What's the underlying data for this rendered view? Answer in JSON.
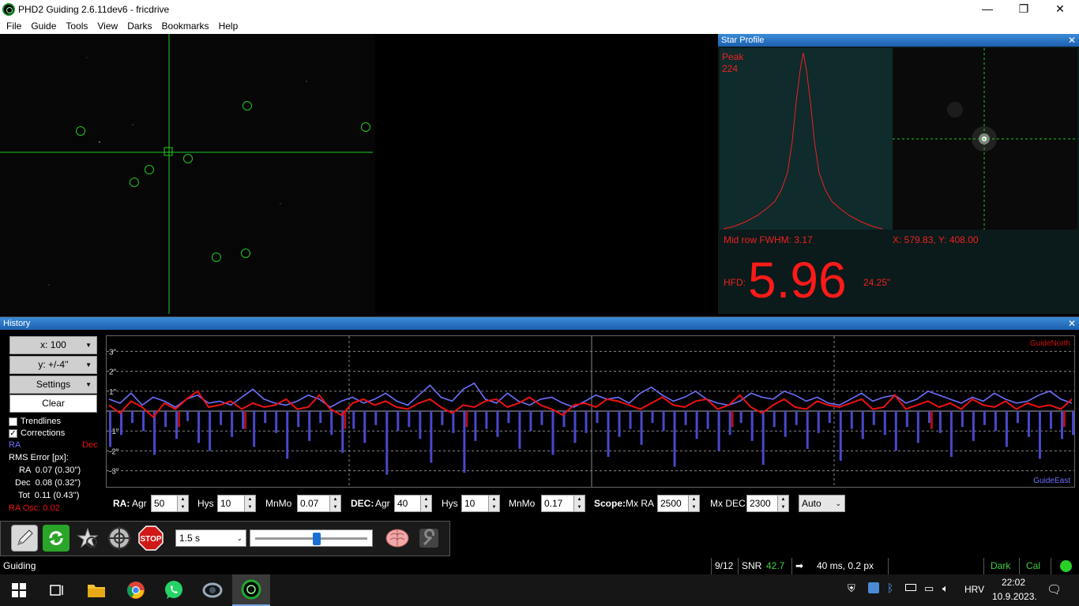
{
  "window": {
    "title": "PHD2 Guiding 2.6.11dev6 - fricdrive",
    "minimize": "—",
    "maximize": "❐",
    "close": "✕"
  },
  "menu": [
    "File",
    "Guide",
    "Tools",
    "View",
    "Darks",
    "Bookmarks",
    "Help"
  ],
  "star_profile": {
    "title": "Star Profile",
    "peak_label": "Peak",
    "peak_value": "224",
    "fwhm": "Mid row FWHM: 3.17",
    "coords": "X: 579.83, Y: 408.00",
    "hfd_label": "HFD:",
    "hfd_value": "5.96",
    "hfd_arcsec": "24.25\""
  },
  "history": {
    "title": "History",
    "x_scale": "x: 100",
    "y_scale": "y: +/-4''",
    "settings": "Settings",
    "clear": "Clear",
    "trendlines": "Trendlines",
    "corrections": "Corrections",
    "ra_label": "RA",
    "dec_label": "Dec",
    "rms_title": "RMS Error [px]:",
    "rms_ra": "RA  0.07 (0.30'')",
    "rms_dec": "Dec  0.08 (0.32'')",
    "rms_tot": "Tot  0.11 (0.43'')",
    "ra_osc": "RA Osc: 0.02",
    "guide_north": "GuideNorth",
    "guide_east": "GuideEast",
    "y_ticks": [
      "3\"",
      "2\"",
      "1\"",
      "-1\"",
      "-2\"",
      "-3\""
    ]
  },
  "chart_data": {
    "type": "line",
    "ylim": [
      -4,
      4
    ],
    "series": [
      {
        "name": "RA",
        "color": "#6f6fff",
        "values": [
          0.6,
          0.4,
          0.9,
          0.3,
          0.7,
          0.5,
          0.2,
          0.6,
          0.8,
          0.4,
          0.5,
          0.3,
          0.7,
          1.1,
          0.6,
          0.4,
          0.3,
          0.5,
          0.8,
          0.6,
          0.2,
          0.5,
          0.7,
          0.4,
          0.6,
          0.9,
          0.5,
          0.3,
          0.8,
          1.3,
          0.7,
          0.5,
          1.1,
          1.4,
          0.6,
          0.4,
          0.9,
          0.5,
          0.3,
          0.6,
          0.7,
          0.4,
          0.2,
          0.5,
          0.8,
          0.6,
          0.7,
          0.4,
          0.9,
          1.2,
          0.8,
          0.5,
          0.7,
          1.0,
          0.6,
          0.4,
          0.3,
          0.5,
          0.9,
          0.7,
          0.6,
          1.0,
          0.8,
          0.5,
          0.7,
          0.4,
          0.3,
          0.6,
          0.9,
          0.5,
          0.7,
          0.8,
          0.4,
          0.6,
          1.0,
          0.8,
          0.6,
          0.4,
          0.7,
          0.5,
          0.9,
          0.6,
          0.4,
          0.5,
          0.8,
          1.0,
          0.6,
          0.4
        ]
      },
      {
        "name": "Dec",
        "color": "#ee1111",
        "values": [
          0.3,
          -0.1,
          0.5,
          0.2,
          -0.3,
          0.4,
          0.1,
          0.6,
          1.0,
          0.2,
          0.3,
          0.5,
          0.1,
          0.4,
          0.2,
          0.3,
          0.6,
          0.1,
          0.2,
          0.8,
          0.1,
          -0.2,
          0.4,
          0.6,
          0.3,
          0.5,
          0.2,
          0.1,
          0.4,
          0.6,
          0.2,
          -0.1,
          0.3,
          0.2,
          0.5,
          0.6,
          0.2,
          0.4,
          0.7,
          0.3,
          0.1,
          -0.2,
          0.3,
          0.4,
          0.2,
          0.6,
          0.5,
          0.3,
          0.1,
          0.4,
          0.7,
          0.3,
          0.2,
          0.5,
          0.6,
          0.1,
          0.3,
          0.8,
          0.2,
          -0.1,
          0.3,
          0.6,
          0.2,
          0.1,
          0.5,
          0.3,
          0.2,
          0.4,
          0.6,
          0.1,
          0.2,
          0.8,
          0.1,
          0.3,
          0.5,
          0.2,
          0.4,
          0.1,
          0.6,
          0.3,
          0.2,
          0.5,
          0.1,
          0.4,
          0.2,
          0.3,
          0.1,
          0.6
        ]
      },
      {
        "name": "RA corrections",
        "color": "#4848cc",
        "values": [
          -1.8,
          -1.2,
          -0.6,
          -1.0,
          -2.2,
          -0.8,
          -1.4,
          -0.5,
          -1.6,
          -2.0,
          -0.7,
          -1.3,
          -0.9,
          -1.8,
          -0.6,
          -1.1,
          -2.4,
          -0.8,
          -1.5,
          -0.6,
          -1.2,
          -2.1,
          -0.9,
          -1.6,
          -0.7,
          -3.2,
          -1.0,
          -0.8,
          -1.4,
          -2.6,
          -0.7,
          -1.1,
          -3.1,
          -1.5,
          -0.9,
          -1.3,
          -0.6,
          -1.9,
          -1.0,
          -0.7,
          -2.2,
          -0.8,
          -1.6,
          -1.1,
          -0.6,
          -2.3,
          -1.3,
          -0.9,
          -1.7,
          -0.6,
          -1.0,
          -2.8,
          -0.7,
          -1.4,
          -0.9,
          -2.0,
          -1.2,
          -0.6,
          -1.5,
          -2.7,
          -0.8,
          -1.3,
          -0.7,
          -1.9,
          -1.1,
          -0.6,
          -2.5,
          -0.9,
          -1.4,
          -0.7,
          -1.2,
          -2.0,
          -0.8,
          -1.6,
          -0.6,
          -1.1,
          -2.3,
          -0.8,
          -1.5,
          -0.7,
          -1.0,
          -1.8,
          -0.6,
          -1.3,
          -2.4,
          -0.9,
          -1.4,
          -1.2
        ]
      },
      {
        "name": "Dec corrections",
        "color": "#aa1111",
        "values": [
          0,
          0,
          0,
          0,
          0,
          0,
          -0.8,
          0,
          0,
          0,
          0,
          0,
          -0.9,
          0,
          0,
          0,
          0,
          0,
          0,
          0,
          0,
          -0.9,
          0,
          0,
          0,
          0,
          0,
          0,
          0,
          0,
          0,
          0,
          -0.8,
          0,
          0,
          0,
          0,
          0,
          0,
          0,
          0,
          0,
          0,
          0,
          0,
          0,
          0,
          0,
          0,
          0,
          0,
          0,
          0,
          0,
          0,
          0,
          -0.8,
          0,
          0,
          0,
          0,
          0,
          0,
          0,
          0,
          0,
          0,
          0,
          0,
          0,
          0,
          0,
          0,
          0,
          -0.9,
          0,
          0,
          0,
          0,
          0,
          0,
          0,
          0,
          0,
          0,
          0,
          -0.8,
          0
        ]
      }
    ]
  },
  "params": {
    "ra_label": "RA:",
    "agr_label": "Agr",
    "ra_agr": "50",
    "hys_label": "Hys",
    "ra_hys": "10",
    "mnmo_label": "MnMo",
    "ra_mnmo": "0.07",
    "dec_label": "DEC:",
    "dec_agr": "40",
    "dec_hys": "10",
    "dec_mnmo": "0.17",
    "scope_label": "Scope:",
    "mxra_label": "Mx RA",
    "mxra": "2500",
    "mxdec_label": "Mx DEC",
    "mxdec": "2300",
    "mode": "Auto"
  },
  "toolbar": {
    "exposure": "1.5 s",
    "exposure_slider_pct": 55
  },
  "status": {
    "guiding": "Guiding",
    "frame": "9/12",
    "snr_label": "SNR",
    "snr": "42.7",
    "guide_step": "40 ms, 0.2 px",
    "dark": "Dark",
    "cal": "Cal"
  },
  "taskbar": {
    "lang": "HRV",
    "time": "22:02",
    "date": "10.9.2023."
  }
}
